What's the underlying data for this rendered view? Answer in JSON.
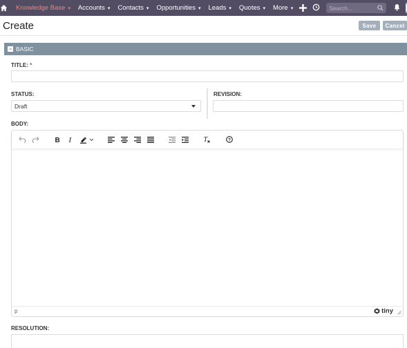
{
  "nav": {
    "items": [
      {
        "label": "Knowledge Base",
        "active": true
      },
      {
        "label": "Accounts"
      },
      {
        "label": "Contacts"
      },
      {
        "label": "Opportunities"
      },
      {
        "label": "Leads"
      },
      {
        "label": "Quotes"
      },
      {
        "label": "More"
      }
    ],
    "search_placeholder": "Search...",
    "icons": [
      "home-icon",
      "plus-icon",
      "history-icon",
      "search-icon",
      "bell-icon",
      "user-icon"
    ]
  },
  "header": {
    "title": "Create",
    "save_label": "Save",
    "cancel_label": "Cancel"
  },
  "panel": {
    "title": "BASIC",
    "collapse_symbol": "−"
  },
  "form": {
    "title_label": "TITLE:",
    "required_mark": "*",
    "title_value": "",
    "status_label": "STATUS:",
    "status_value": "Draft",
    "revision_label": "REVISION:",
    "revision_value": "",
    "body_label": "BODY:",
    "resolution_label": "RESOLUTION:"
  },
  "editor": {
    "toolbar": [
      "undo-icon",
      "redo-icon",
      "bold-icon",
      "italic-icon",
      "highlight-icon",
      "align-left-icon",
      "align-center-icon",
      "align-right-icon",
      "justify-icon",
      "outdent-icon",
      "indent-icon",
      "clear-format-icon",
      "help-icon"
    ],
    "status_path": "p",
    "brand": "tiny"
  },
  "colors": {
    "nav_bg": "#534d64",
    "nav_active": "#f08377",
    "panel_bg": "#7f919e",
    "button_bg": "#a3afbb",
    "required": "#d03f3f"
  }
}
